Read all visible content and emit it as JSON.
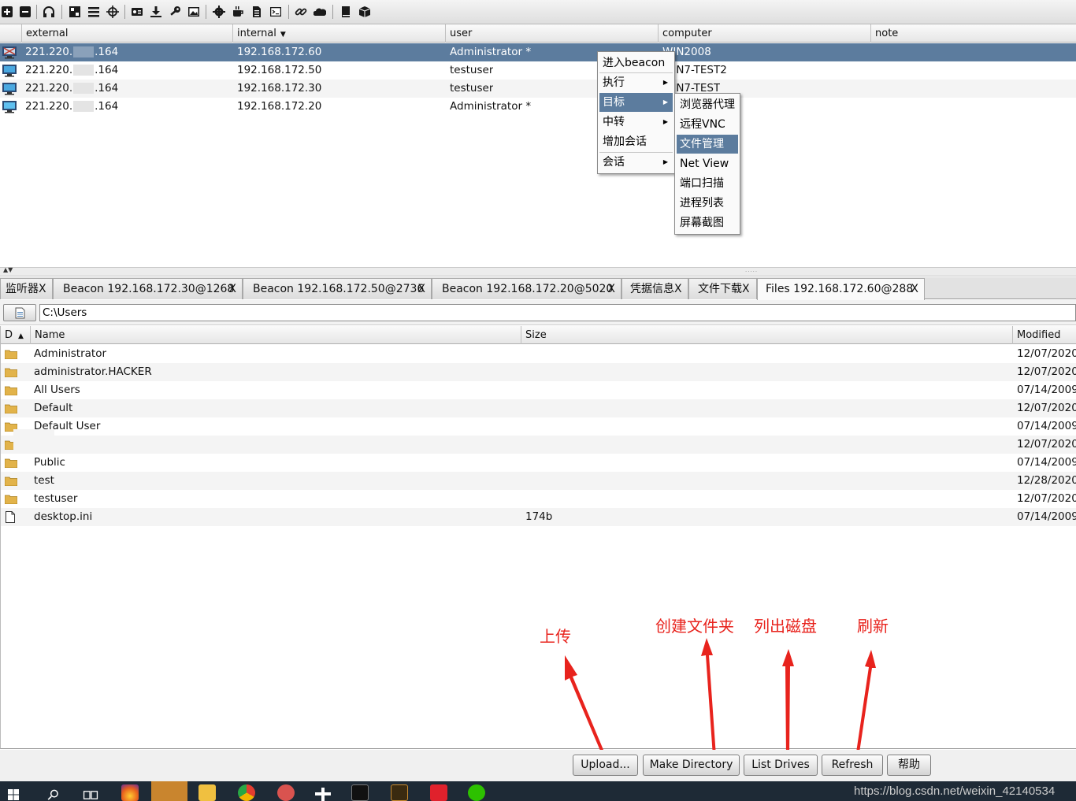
{
  "beacons": {
    "columns": [
      "external",
      "internal",
      "user",
      "computer",
      "note"
    ],
    "rows": [
      {
        "external_start": "221.220.",
        "external_end": ".164",
        "internal": "192.168.172.60",
        "user": "Administrator *",
        "computer": "WIN2008",
        "note": "",
        "selected": true
      },
      {
        "external_start": "221.220.",
        "external_end": ".164",
        "internal": "192.168.172.50",
        "user": "testuser",
        "computer": "WIN7-TEST2",
        "note": "",
        "selected": false
      },
      {
        "external_start": "221.220.",
        "external_end": ".164",
        "internal": "192.168.172.30",
        "user": "testuser",
        "computer": "WIN7-TEST",
        "note": "",
        "selected": false
      },
      {
        "external_start": "221.220.",
        "external_end": ".164",
        "internal": "192.168.172.20",
        "user": "Administrator *",
        "computer": "",
        "note": "",
        "selected": false
      }
    ]
  },
  "context_menu": {
    "items": [
      "进入beacon",
      "执行",
      "目标",
      "中转",
      "增加会话",
      "会话"
    ],
    "highlighted": "目标"
  },
  "submenu": {
    "items": [
      "浏览器代理",
      "远程VNC",
      "文件管理",
      "Net View",
      "端口扫描",
      "进程列表",
      "屏幕截图"
    ],
    "highlighted": "文件管理"
  },
  "tabs": [
    {
      "label": "监听器",
      "close": "X"
    },
    {
      "label": "Beacon 192.168.172.30@1268",
      "close": "X"
    },
    {
      "label": "Beacon 192.168.172.50@2736",
      "close": "X"
    },
    {
      "label": "Beacon 192.168.172.20@5020",
      "close": "X"
    },
    {
      "label": "凭据信息",
      "close": "X"
    },
    {
      "label": "文件下载",
      "close": "X"
    },
    {
      "label": "Files 192.168.172.60@288",
      "close": "X",
      "active": true
    }
  ],
  "path": {
    "value": "C:\\Users"
  },
  "files": {
    "columns": [
      "D",
      "Name",
      "Size",
      "Modified"
    ],
    "rows": [
      {
        "type": "folder",
        "name": "Administrator",
        "size": "",
        "modified": "12/07/2020"
      },
      {
        "type": "folder",
        "name": "administrator.HACKER",
        "size": "",
        "modified": "12/07/2020"
      },
      {
        "type": "folder",
        "name": "All Users",
        "size": "",
        "modified": "07/14/2009"
      },
      {
        "type": "folder",
        "name": "Default",
        "size": "",
        "modified": "12/07/2020"
      },
      {
        "type": "folder",
        "name": "Default User",
        "size": "",
        "modified": "07/14/2009"
      },
      {
        "type": "folder",
        "name": "",
        "size": "",
        "modified": "12/07/2020"
      },
      {
        "type": "folder",
        "name": "Public",
        "size": "",
        "modified": "07/14/2009"
      },
      {
        "type": "folder",
        "name": "test",
        "size": "",
        "modified": "12/28/2020"
      },
      {
        "type": "folder",
        "name": "testuser",
        "size": "",
        "modified": "12/07/2020"
      },
      {
        "type": "file",
        "name": "desktop.ini",
        "size": "174b",
        "modified": "07/14/2009"
      }
    ]
  },
  "buttons": {
    "upload": "Upload...",
    "make_directory": "Make Directory",
    "list_drives": "List Drives",
    "refresh": "Refresh",
    "help": "帮助"
  },
  "annotations": {
    "upload": "上传",
    "make_directory": "创建文件夹",
    "list_drives": "列出磁盘",
    "refresh": "刷新"
  },
  "watermark": "https://blog.csdn.net/weixin_42140534",
  "colors": {
    "selection": "#5c7c9e",
    "annotation": "#e8231d",
    "taskbar": "#1e2a36"
  }
}
